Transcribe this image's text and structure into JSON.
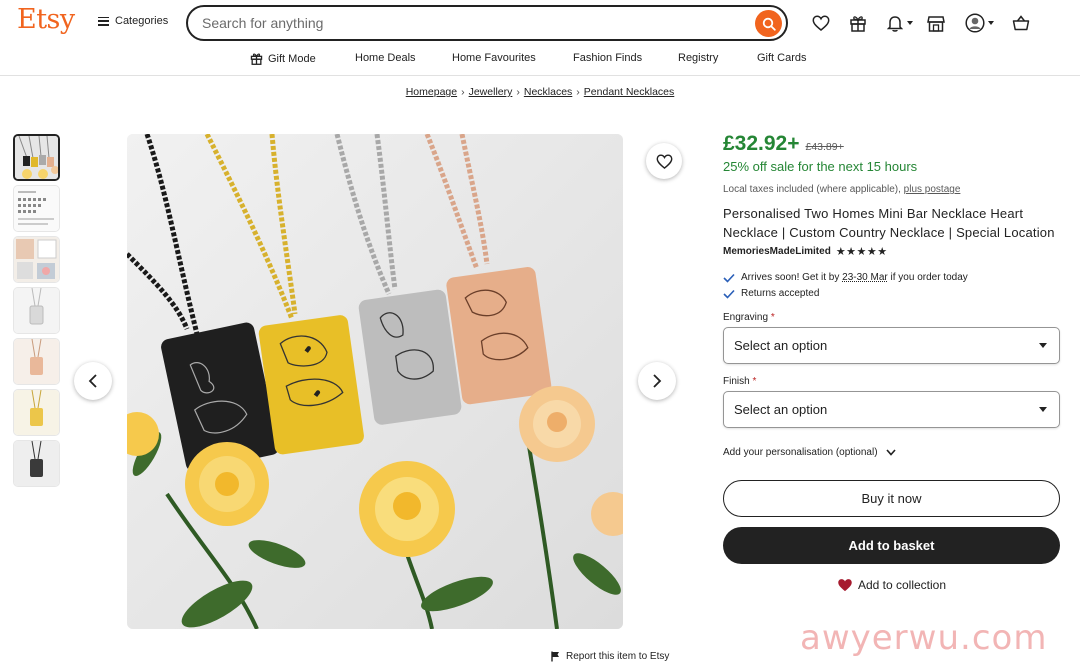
{
  "header": {
    "logo": "Etsy",
    "categories_label": "Categories",
    "search_placeholder": "Search for anything"
  },
  "subnav": {
    "items": [
      "Gift Mode",
      "Home Deals",
      "Home Favourites",
      "Fashion Finds",
      "Registry",
      "Gift Cards"
    ]
  },
  "breadcrumb": [
    "Homepage",
    "Jewellery",
    "Necklaces",
    "Pendant Necklaces"
  ],
  "product": {
    "price": "£32.92+",
    "old_price": "£43.89+",
    "sale_text": "25% off sale for the next 15 hours",
    "tax_text": "Local taxes included (where applicable),",
    "tax_link": "plus postage",
    "title": "Personalised Two Homes Mini Bar Necklace Heart Necklace | Custom Country Necklace | Special Location",
    "shop_name": "MemoriesMadeLimited",
    "rating_stars": 5,
    "arrives_prefix": "Arrives soon! Get it by",
    "arrives_date": "23-30 Mar",
    "arrives_suffix": "if you order today",
    "returns": "Returns accepted",
    "engraving_label": "Engraving",
    "engraving_value": "Select an option",
    "finish_label": "Finish",
    "finish_value": "Select an option",
    "personalisation_label": "Add your personalisation (optional)",
    "buy_now": "Buy it now",
    "add_to_basket": "Add to basket",
    "add_to_collection": "Add to collection",
    "report": "Report this item to Etsy"
  },
  "watermark": "awyerwu.com",
  "colors": {
    "brand": "#f1641e",
    "sale_green": "#258635",
    "dark_button": "#222222"
  }
}
